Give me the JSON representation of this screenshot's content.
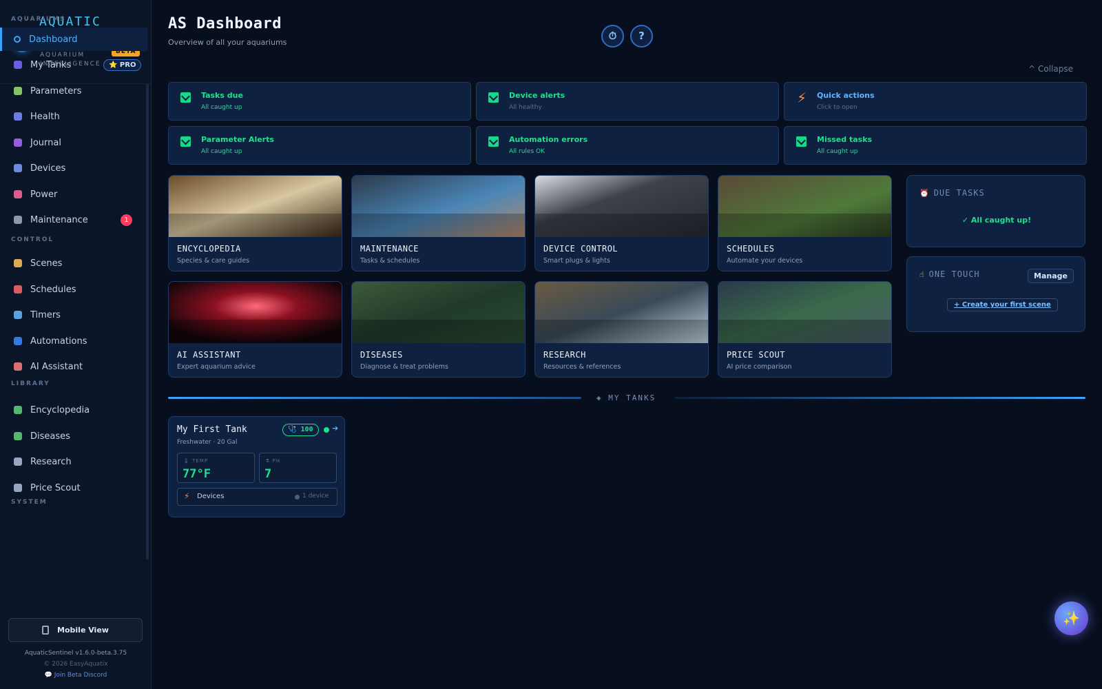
{
  "brand": {
    "name": "AQUATIC SENTINEL",
    "tagline": "AQUARIUM INTELLIGENCE",
    "beta": "BETA",
    "pro": "⭐ PRO"
  },
  "sidebar": {
    "sections": [
      {
        "label": "AQUARIUMS"
      },
      {
        "label": "CONTROL"
      },
      {
        "label": "LIBRARY"
      },
      {
        "label": "SYSTEM"
      }
    ],
    "items": [
      {
        "label": "Dashboard",
        "icon": "circle-icon",
        "color": "#3aa4ff",
        "active": true
      },
      {
        "label": "My Tanks",
        "icon": "globe-icon",
        "color": "#7f6bff"
      },
      {
        "label": "Parameters",
        "icon": "pipette-icon",
        "color": "#9be36f"
      },
      {
        "label": "Health",
        "icon": "stethoscope-icon",
        "color": "#7f8cff"
      },
      {
        "label": "Journal",
        "icon": "book-icon",
        "color": "#b06aff"
      },
      {
        "label": "Devices",
        "icon": "grid-icon",
        "color": "#7f9fff"
      },
      {
        "label": "Power",
        "icon": "plug-icon",
        "color": "#ff6b9d"
      },
      {
        "label": "Maintenance",
        "icon": "wrench-icon",
        "color": "#a0b0c8",
        "count": "1"
      },
      {
        "label": "Scenes",
        "icon": "hand-icon",
        "color": "#ffc85a"
      },
      {
        "label": "Schedules",
        "icon": "alarm-icon",
        "color": "#ff6b6b"
      },
      {
        "label": "Timers",
        "icon": "stopwatch-icon",
        "color": "#6ab8ff"
      },
      {
        "label": "Automations",
        "icon": "repeat-icon",
        "color": "#3d8bff"
      },
      {
        "label": "AI Assistant",
        "icon": "robot-icon",
        "color": "#ff8080"
      },
      {
        "label": "Encyclopedia",
        "icon": "books-icon",
        "color": "#66d17e"
      },
      {
        "label": "Diseases",
        "icon": "microbe-icon",
        "color": "#66d17e"
      },
      {
        "label": "Research",
        "icon": "microscope-icon",
        "color": "#b0c0d8"
      },
      {
        "label": "Price Scout",
        "icon": "receipt-icon",
        "color": "#b0c0d8"
      }
    ],
    "mobile_view": "Mobile View",
    "version": "AquaticSentinel v1.6.0-beta.3.75",
    "copyright": "© 2026 EasyAquatix",
    "discord": "💬 Join Beta Discord"
  },
  "header": {
    "title": "AS Dashboard",
    "subtitle": "Overview of all your aquariums",
    "timer_icon": "⏱",
    "help_label": "?",
    "collapse": "^ Collapse"
  },
  "status_cards": [
    {
      "title": "Tasks due",
      "sub": "All caught up",
      "icon": "check"
    },
    {
      "title": "Device alerts",
      "sub": "All healthy",
      "icon": "check"
    },
    {
      "title": "Quick actions",
      "sub": "Click to open",
      "icon": "bolt"
    },
    {
      "title": "Parameter Alerts",
      "sub": "All caught up",
      "icon": "check"
    },
    {
      "title": "Automation errors",
      "sub": "All rules OK",
      "icon": "check"
    },
    {
      "title": "Missed tasks",
      "sub": "All caught up",
      "icon": "check"
    }
  ],
  "tiles": [
    {
      "name": "ENCYCLOPEDIA",
      "desc": "Species & care guides"
    },
    {
      "name": "MAINTENANCE",
      "desc": "Tasks & schedules"
    },
    {
      "name": "DEVICE CONTROL",
      "desc": "Smart plugs & lights"
    },
    {
      "name": "SCHEDULES",
      "desc": "Automate your devices"
    },
    {
      "name": "AI ASSISTANT",
      "desc": "Expert aquarium advice"
    },
    {
      "name": "DISEASES",
      "desc": "Diagnose & treat problems"
    },
    {
      "name": "RESEARCH",
      "desc": "Resources & references"
    },
    {
      "name": "PRICE SCOUT",
      "desc": "AI price comparison"
    }
  ],
  "due_tasks": {
    "title": "DUE TASKS",
    "empty": "✓ All caught up!"
  },
  "one_touch": {
    "title": "ONE TOUCH",
    "manage": "Manage",
    "create": "+ Create your first scene"
  },
  "my_tanks": {
    "label": "◈ MY TANKS",
    "tanks": [
      {
        "name": "My First Tank",
        "meta": "Freshwater · 20 Gal",
        "health": "🩺 100",
        "arrow": "➔",
        "temp_label": "🌡 TEMP",
        "temp_value": "77°F",
        "ph_label": "⚗ PH",
        "ph_value": "7",
        "devices_label": "Devices",
        "devices_count": "1 device"
      }
    ]
  },
  "fab": {
    "icon": "✨"
  }
}
